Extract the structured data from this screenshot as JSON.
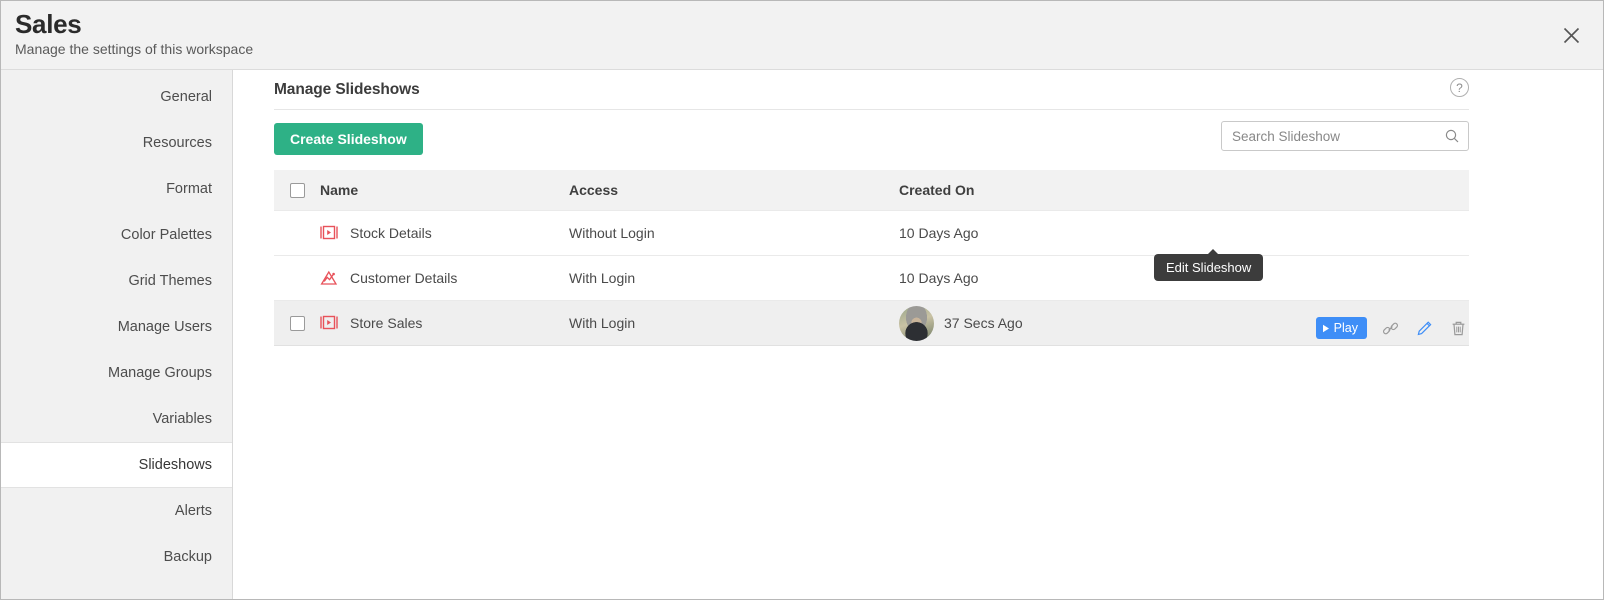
{
  "header": {
    "title": "Sales",
    "subtitle": "Manage the settings of this workspace",
    "close_icon": "close-icon"
  },
  "sidebar": {
    "items": [
      {
        "label": "General",
        "active": false
      },
      {
        "label": "Resources",
        "active": false
      },
      {
        "label": "Format",
        "active": false
      },
      {
        "label": "Color Palettes",
        "active": false
      },
      {
        "label": "Grid Themes",
        "active": false
      },
      {
        "label": "Manage Users",
        "active": false
      },
      {
        "label": "Manage Groups",
        "active": false
      },
      {
        "label": "Variables",
        "active": false
      },
      {
        "label": "Slideshows",
        "active": true
      },
      {
        "label": "Alerts",
        "active": false
      },
      {
        "label": "Backup",
        "active": false
      }
    ]
  },
  "main": {
    "panel_title": "Manage Slideshows",
    "help_icon_label": "?",
    "create_button": "Create Slideshow",
    "search": {
      "placeholder": "Search Slideshow",
      "value": "",
      "icon": "search-icon"
    },
    "table": {
      "columns": [
        "Name",
        "Access",
        "Created On"
      ],
      "rows": [
        {
          "name": "Stock Details",
          "access": "Without Login",
          "created_on": "10 Days Ago",
          "type_icon": "slideshow-icon",
          "checkbox_visible": false,
          "avatar_visible": false,
          "hovered": false
        },
        {
          "name": "Customer Details",
          "access": "With Login",
          "created_on": "10 Days Ago",
          "type_icon": "chart-icon",
          "checkbox_visible": false,
          "avatar_visible": false,
          "hovered": false
        },
        {
          "name": "Store Sales",
          "access": "With Login",
          "created_on": "37 Secs Ago",
          "type_icon": "slideshow-icon",
          "checkbox_visible": true,
          "avatar_visible": true,
          "hovered": true
        }
      ]
    },
    "row_actions": {
      "play_label": "Play",
      "link_icon": "link-icon",
      "edit_icon": "pencil-icon",
      "delete_icon": "trash-icon"
    },
    "tooltip": "Edit Slideshow"
  },
  "colors": {
    "accent_green": "#2eb186",
    "accent_blue": "#3e8ef7",
    "icon_red": "#e8525a",
    "tooltip_bg": "#3c3c3c"
  }
}
